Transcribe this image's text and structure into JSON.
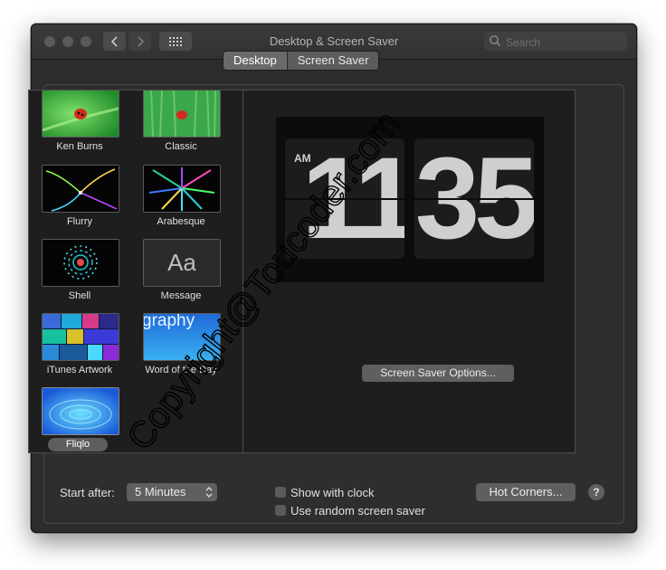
{
  "window": {
    "title": "Desktop & Screen Saver"
  },
  "search": {
    "placeholder": "Search"
  },
  "tabs": [
    {
      "label": "Desktop",
      "active": true
    },
    {
      "label": "Screen Saver",
      "active": false
    }
  ],
  "screen_savers": [
    {
      "label": "Ken Burns"
    },
    {
      "label": "Classic"
    },
    {
      "label": "Flurry"
    },
    {
      "label": "Arabesque"
    },
    {
      "label": "Shell"
    },
    {
      "label": "Message",
      "thumb_text": "Aa"
    },
    {
      "label": "iTunes Artwork"
    },
    {
      "label": "Word of the Day",
      "thumb_text": "graphy"
    },
    {
      "label": "Fliqlo",
      "selected": true
    }
  ],
  "preview": {
    "ampm": "AM",
    "hour": "11",
    "minute": "35"
  },
  "options_button": "Screen Saver Options...",
  "start_after": {
    "label": "Start after:",
    "value": "5 Minutes"
  },
  "show_with_clock": {
    "label": "Show with clock",
    "checked": false
  },
  "random_saver": {
    "label": "Use random screen saver",
    "checked": false
  },
  "hot_corners_button": "Hot Corners...",
  "help_button": "?",
  "watermark": "Copyright@Toucoder.com"
}
